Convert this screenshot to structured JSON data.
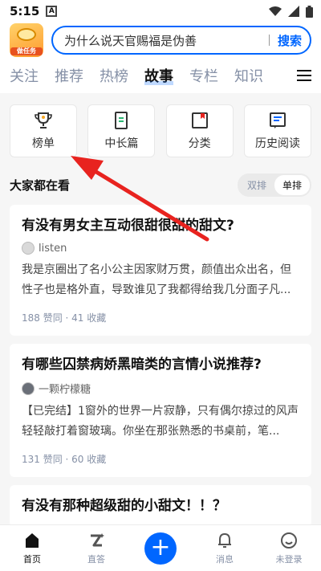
{
  "status_bar": {
    "time": "5:15",
    "notification": "A"
  },
  "header": {
    "logo_text": "做任务",
    "search_text": "为什么说天官赐福是伪善",
    "search_button": "搜索"
  },
  "tabs": [
    "关注",
    "推荐",
    "热榜",
    "故事",
    "专栏",
    "知识"
  ],
  "active_tab": "故事",
  "quick_links": [
    {
      "label": "榜单",
      "icon": "trophy-icon"
    },
    {
      "label": "中长篇",
      "icon": "book-icon"
    },
    {
      "label": "分类",
      "icon": "category-icon"
    },
    {
      "label": "历史阅读",
      "icon": "history-icon"
    }
  ],
  "section": {
    "title": "大家都在看",
    "toggle_double": "双排",
    "toggle_single": "单排"
  },
  "cards": [
    {
      "title": "有没有男女主互动很甜很甜的甜文?",
      "author": "listen",
      "excerpt": "我是京圈出了名小公主因家财万贯，颜值出众出名，但性子也是格外直，导致谁见了我都得给我几分面子凡...",
      "stats": "188 赞同 · 41 收藏"
    },
    {
      "title": "有哪些囚禁病娇黑暗类的言情小说推荐?",
      "author": "一颗柠檬糖",
      "excerpt": "【已完结】1窗外的世界一片寂静，只有偶尔掠过的风声轻轻敲打着窗玻璃。你坐在那张熟悉的书桌前，笔...",
      "stats": "131 赞同 · 60 收藏"
    },
    {
      "title": "有没有那种超级甜的小甜文！！？"
    }
  ],
  "bottom_nav": {
    "home": "首页",
    "live": "直答",
    "messages": "消息",
    "profile": "未登录"
  },
  "colors": {
    "accent": "#0066ff",
    "annotation_arrow": "#e8231f"
  }
}
